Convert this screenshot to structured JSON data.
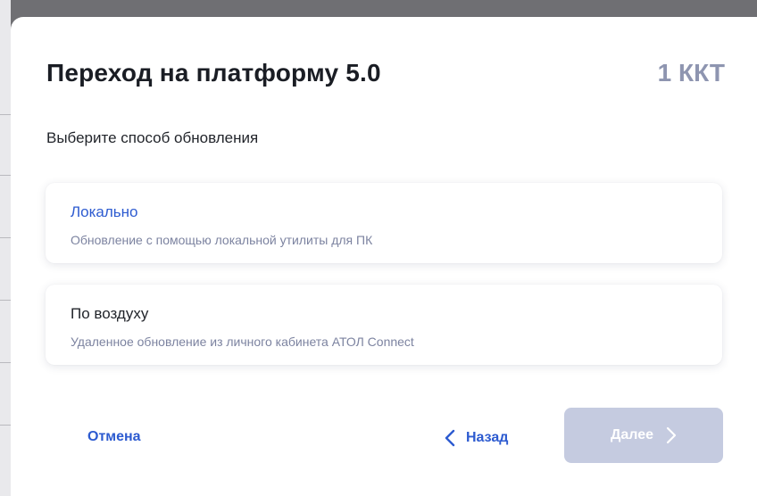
{
  "dialog": {
    "title": "Переход на платформу 5.0",
    "count": "1 ККТ",
    "subtitle": "Выберите способ обновления"
  },
  "options": [
    {
      "title": "Локально",
      "description": "Обновление с помощью локальной утилиты для ПК",
      "highlighted": true
    },
    {
      "title": "По воздуху",
      "description": "Удаленное обновление из личного кабинета АТОЛ Connect",
      "highlighted": false
    }
  ],
  "footer": {
    "cancel_label": "Отмена",
    "back_label": "Назад",
    "next_label": "Далее",
    "next_disabled": true
  },
  "icons": {
    "back": "chevron-left-icon",
    "next": "chevron-right-icon"
  },
  "colors": {
    "accent": "#2d5bd0",
    "muted": "#8e95b0",
    "disabled_button": "#c5cbe0",
    "overlay": "#6f6f73"
  }
}
